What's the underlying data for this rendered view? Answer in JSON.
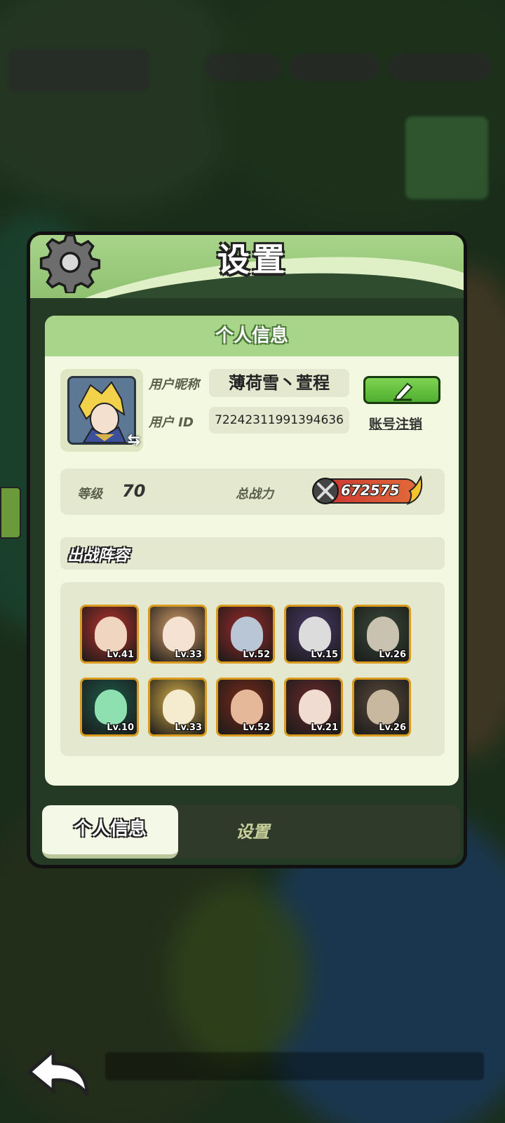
{
  "dialog": {
    "title": "设置",
    "section_title": "个人信息",
    "nickname_label": "用户昵称",
    "nickname_value": "薄荷雪丶萱程",
    "userid_label": "用户 ID",
    "userid_value": "72242311991394636",
    "cancel_account_label": "账号注销",
    "level_label": "等级",
    "level_value": "70",
    "power_label": "总战力",
    "power_value": "672575",
    "lineup_title": "出战阵容"
  },
  "heroes": [
    {
      "level": "Lv.41",
      "bg": "#b8322c"
    },
    {
      "level": "Lv.33",
      "bg": "#d9a16a"
    },
    {
      "level": "Lv.52",
      "bg": "#9c2a2a"
    },
    {
      "level": "Lv.15",
      "bg": "#4a3a6a"
    },
    {
      "level": "Lv.26",
      "bg": "#3a4a3a"
    },
    {
      "level": "Lv.10",
      "bg": "#1e5a4a"
    },
    {
      "level": "Lv.33",
      "bg": "#d8b04a"
    },
    {
      "level": "Lv.52",
      "bg": "#7a2a1a"
    },
    {
      "level": "Lv.21",
      "bg": "#6a2a2a"
    },
    {
      "level": "Lv.26",
      "bg": "#5a4a3a"
    }
  ],
  "tabs": {
    "active": "个人信息",
    "idle": "设置"
  },
  "colors": {
    "panel_green": "#a8d58a",
    "card_bg": "#f3f9e0",
    "edit_green": "#5fc13a"
  }
}
